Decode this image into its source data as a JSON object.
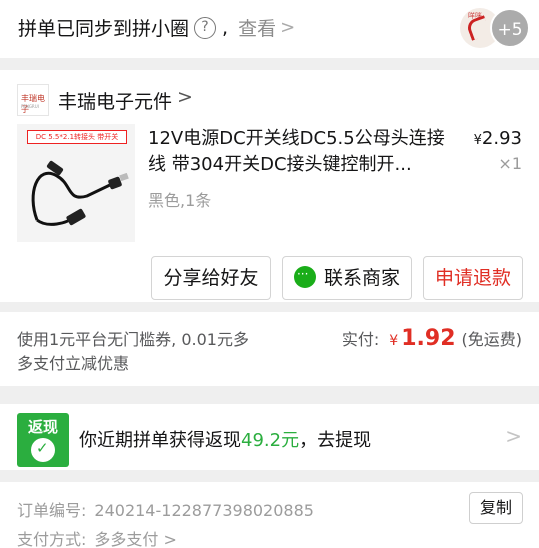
{
  "sync_bar": {
    "text": "拼单已同步到拼小圈",
    "help_glyph": "?",
    "comma": ",",
    "view_label": "查看",
    "chevron": ">",
    "avatar_text": "咩咪",
    "more_count": "+5"
  },
  "shop": {
    "logo_line1": "丰瑞电子",
    "logo_line2": "FENGRUI",
    "name": "丰瑞电子元件",
    "chevron": ">"
  },
  "product": {
    "thumb_tag": "DC 5.5*2.1转接头 带开关",
    "title": "12V电源DC开关线DC5.5公母头连接线 带304开关DC接头键控制开...",
    "spec": "黑色,1条",
    "price_symbol": "¥",
    "price": "2.93",
    "quantity": "×1"
  },
  "actions": {
    "share_label": "分享给好友",
    "contact_label": "联系商家",
    "refund_label": "申请退款"
  },
  "payment": {
    "coupon_text": "使用1元平台无门槛券, 0.01元多多支付立减优惠",
    "paid_label": "实付:",
    "currency": "¥",
    "amount": "1.92",
    "shipping_note": "(免运费)"
  },
  "cashback": {
    "badge_label": "返现",
    "text_before": "你近期拼单获得返现",
    "amount": "49.2元",
    "text_after": "，去提现",
    "chevron": ">"
  },
  "order_info": {
    "number_label": "订单编号:",
    "number_value": "240214-122877398020885",
    "copy_label": "复制",
    "payment_label": "支付方式:",
    "payment_value": "多多支付 >"
  },
  "colors": {
    "accent_red": "#e02e24",
    "cashback_green": "#2bae3f",
    "wechat_green": "#1aad19"
  }
}
